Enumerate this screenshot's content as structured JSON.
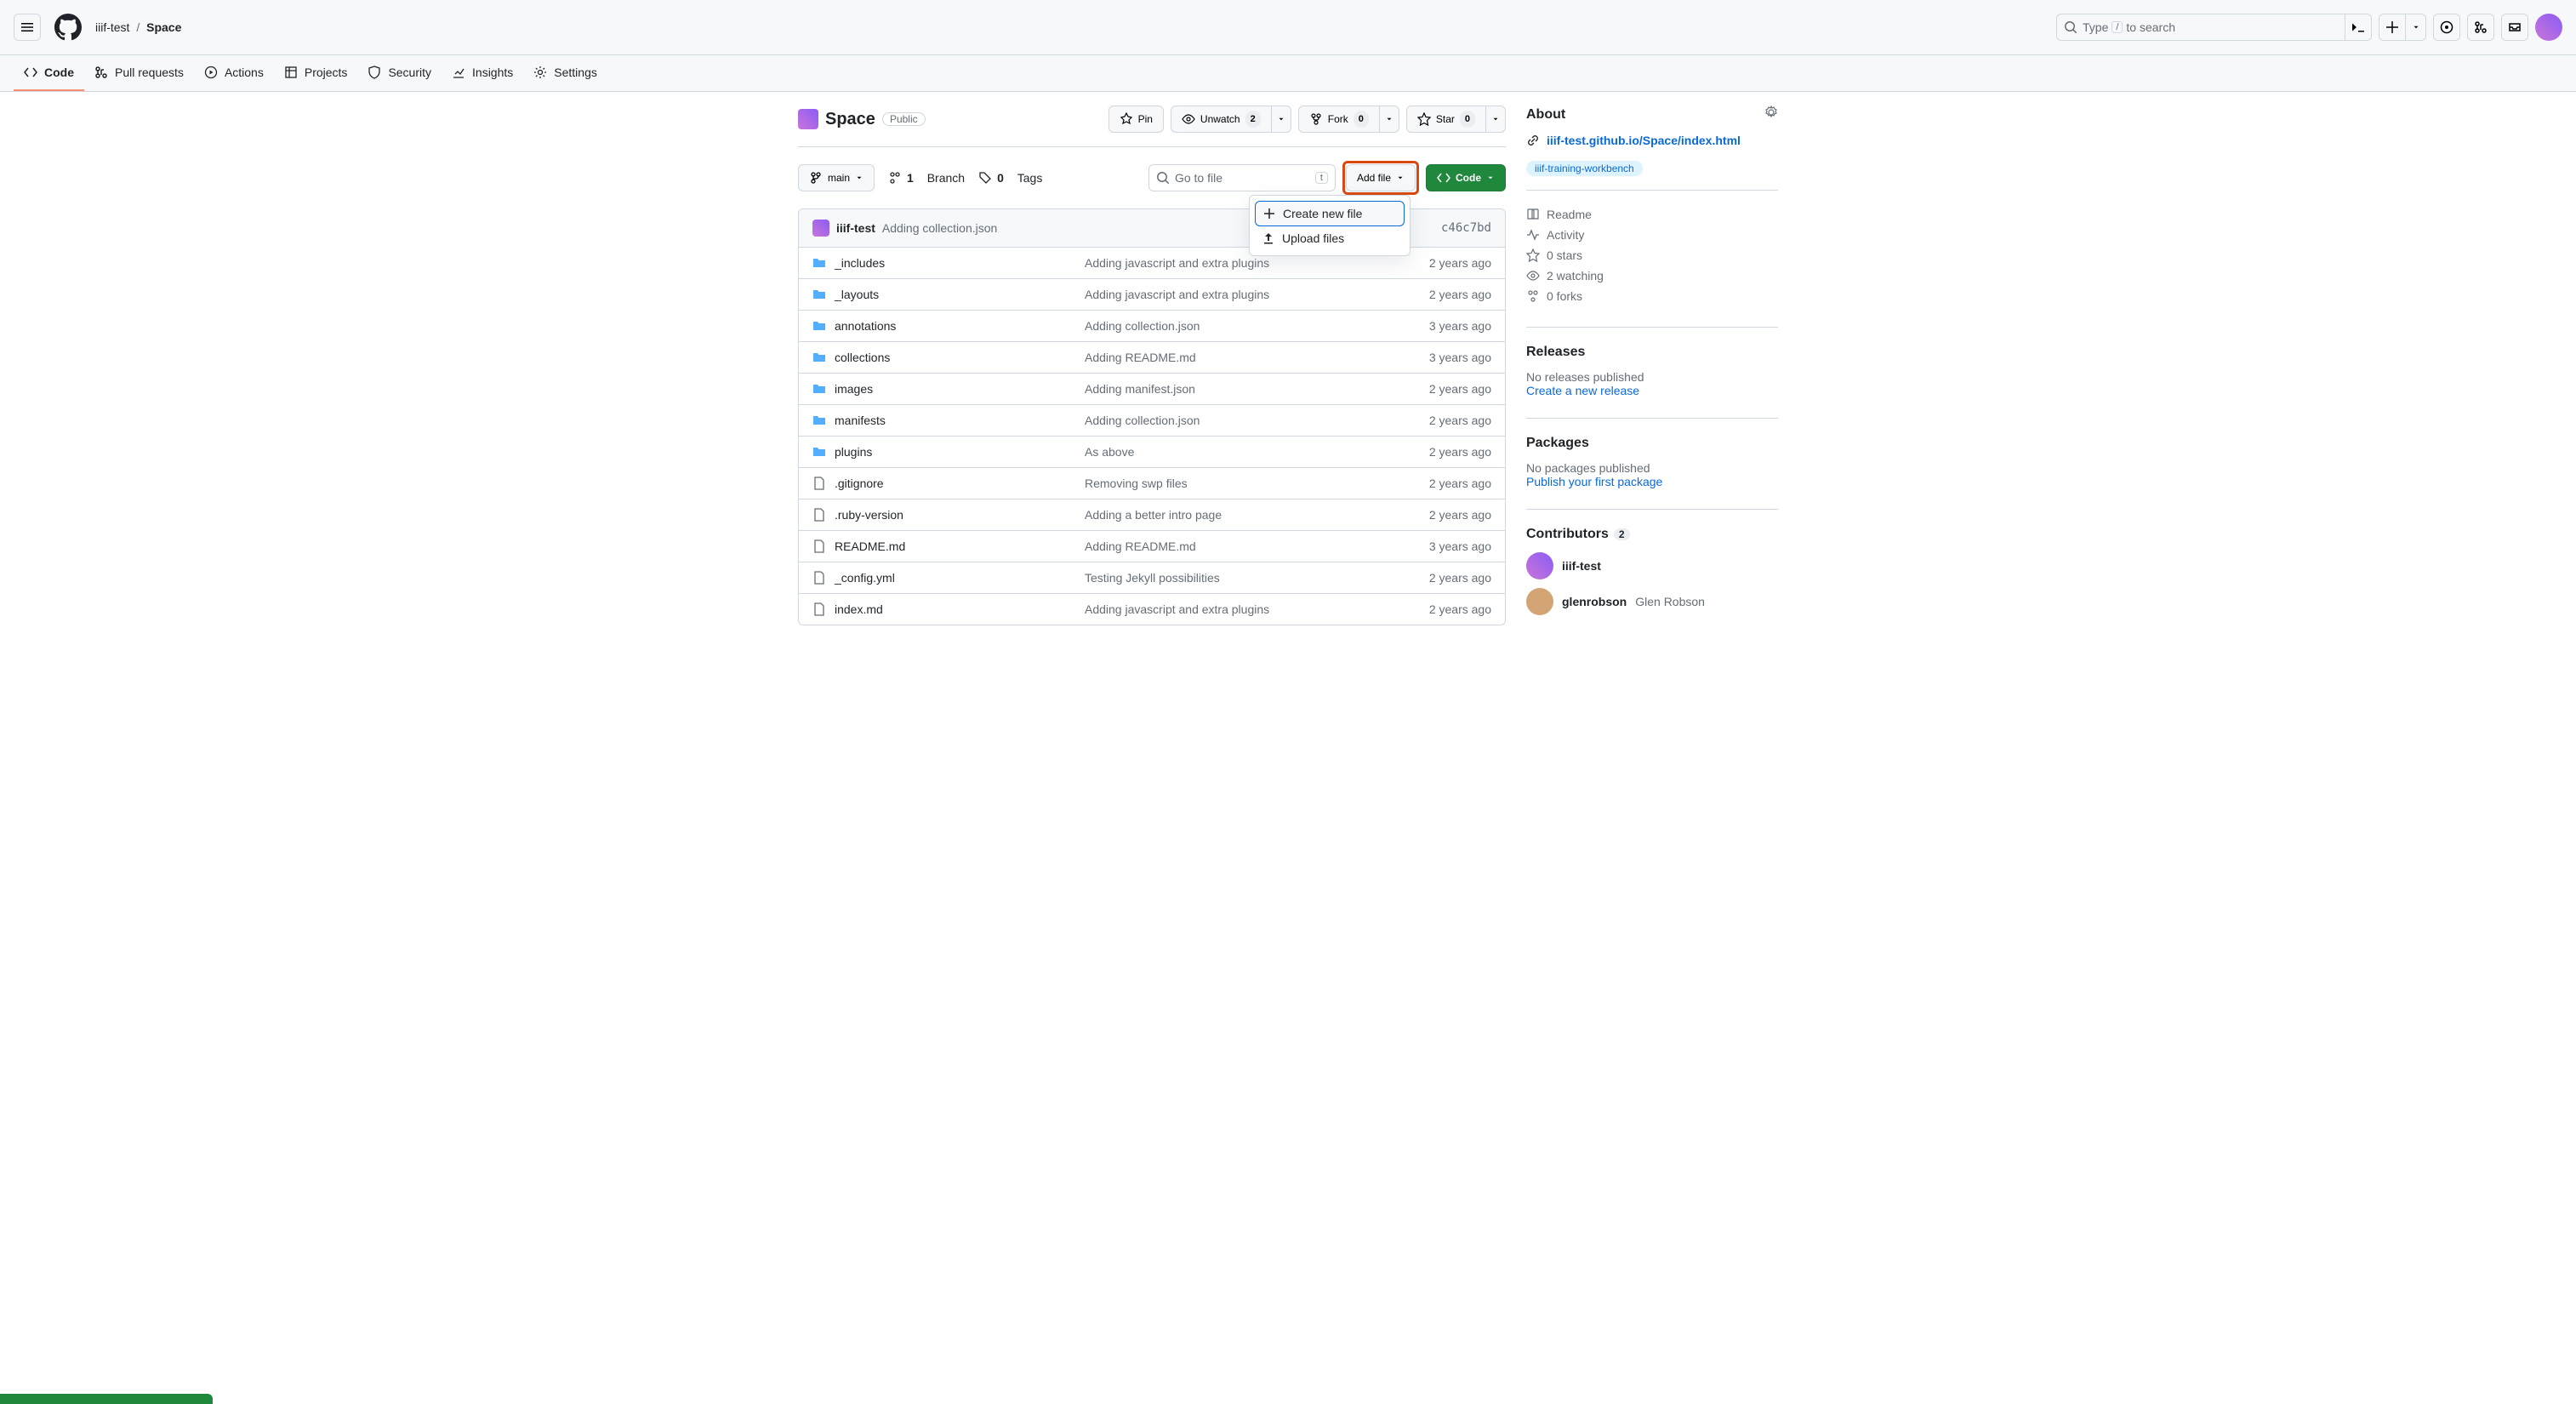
{
  "header": {
    "owner": "iiif-test",
    "repo": "Space",
    "search_placeholder": "Type",
    "search_suffix": "to search"
  },
  "repo_nav": [
    {
      "icon": "code",
      "label": "Code",
      "active": true
    },
    {
      "icon": "pr",
      "label": "Pull requests",
      "active": false
    },
    {
      "icon": "play",
      "label": "Actions",
      "active": false
    },
    {
      "icon": "table",
      "label": "Projects",
      "active": false
    },
    {
      "icon": "shield",
      "label": "Security",
      "active": false
    },
    {
      "icon": "graph",
      "label": "Insights",
      "active": false
    },
    {
      "icon": "gear",
      "label": "Settings",
      "active": false
    }
  ],
  "repo_header": {
    "name": "Space",
    "visibility": "Public",
    "pin": "Pin",
    "unwatch": "Unwatch",
    "unwatch_count": "2",
    "fork": "Fork",
    "fork_count": "0",
    "star": "Star",
    "star_count": "0"
  },
  "toolbar": {
    "branch": "main",
    "branches_count": "1",
    "branches_label": "Branch",
    "tags_count": "0",
    "tags_label": "Tags",
    "go_to_file": "Go to file",
    "go_to_file_key": "t",
    "add_file": "Add file",
    "code_btn": "Code"
  },
  "dropdown": {
    "create_new_file": "Create new file",
    "upload_files": "Upload files"
  },
  "latest_commit": {
    "author": "iiif-test",
    "message": "Adding collection.json",
    "short_sha": "c46c7bd"
  },
  "files": [
    {
      "type": "dir",
      "name": "_includes",
      "msg": "Adding javascript and extra plugins",
      "time": "2 years ago"
    },
    {
      "type": "dir",
      "name": "_layouts",
      "msg": "Adding javascript and extra plugins",
      "time": "2 years ago"
    },
    {
      "type": "dir",
      "name": "annotations",
      "msg": "Adding collection.json",
      "time": "3 years ago"
    },
    {
      "type": "dir",
      "name": "collections",
      "msg": "Adding README.md",
      "time": "3 years ago"
    },
    {
      "type": "dir",
      "name": "images",
      "msg": "Adding manifest.json",
      "time": "2 years ago"
    },
    {
      "type": "dir",
      "name": "manifests",
      "msg": "Adding collection.json",
      "time": "2 years ago"
    },
    {
      "type": "dir",
      "name": "plugins",
      "msg": "As above",
      "time": "2 years ago"
    },
    {
      "type": "file",
      "name": ".gitignore",
      "msg": "Removing swp files",
      "time": "2 years ago"
    },
    {
      "type": "file",
      "name": ".ruby-version",
      "msg": "Adding a better intro page",
      "time": "2 years ago"
    },
    {
      "type": "file",
      "name": "README.md",
      "msg": "Adding README.md",
      "time": "3 years ago"
    },
    {
      "type": "file",
      "name": "_config.yml",
      "msg": "Testing Jekyll possibilities",
      "time": "2 years ago"
    },
    {
      "type": "file",
      "name": "index.md",
      "msg": "Adding javascript and extra plugins",
      "time": "2 years ago"
    }
  ],
  "about": {
    "heading": "About",
    "url": "iiif-test.github.io/Space/index.html",
    "topic": "iiif-training-workbench",
    "readme": "Readme",
    "activity": "Activity",
    "stars": "0 stars",
    "watching": "2 watching",
    "forks": "0 forks"
  },
  "releases": {
    "heading": "Releases",
    "none": "No releases published",
    "create": "Create a new release"
  },
  "packages": {
    "heading": "Packages",
    "none": "No packages published",
    "publish": "Publish your first package"
  },
  "contributors": {
    "heading": "Contributors",
    "count": "2",
    "list": [
      {
        "login": "iiif-test",
        "name": ""
      },
      {
        "login": "glenrobson",
        "name": "Glen Robson"
      }
    ]
  }
}
